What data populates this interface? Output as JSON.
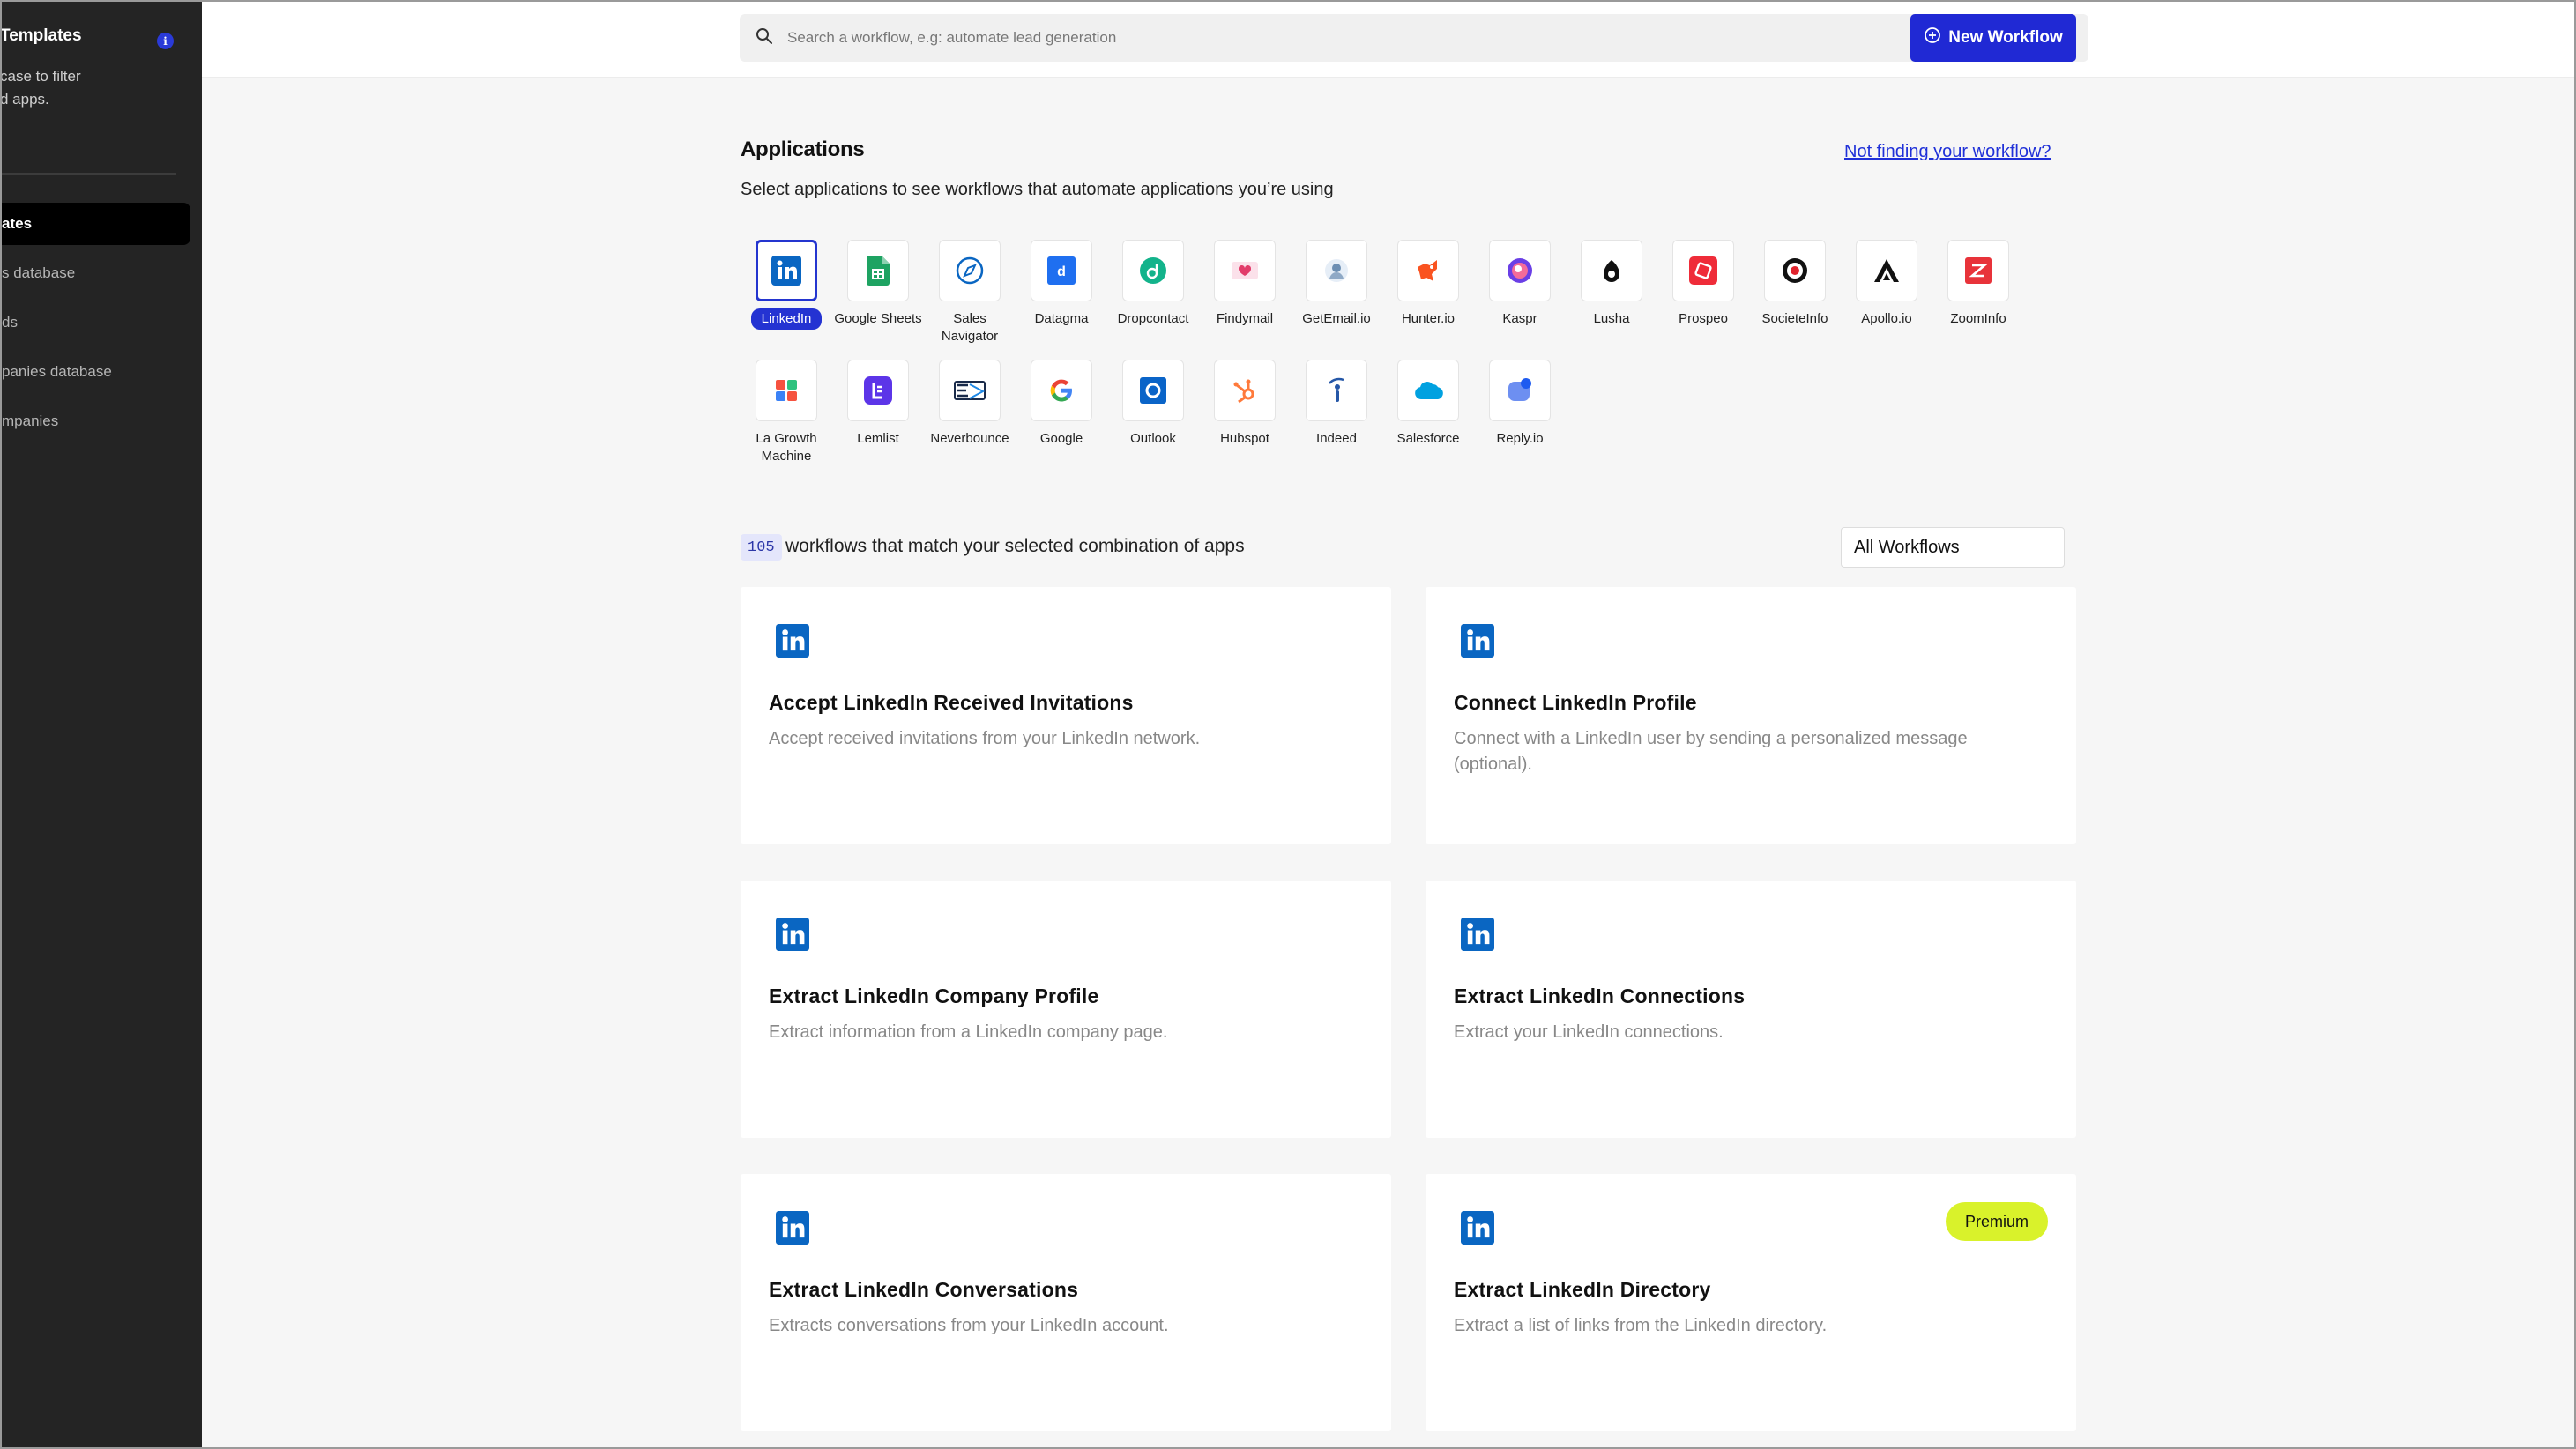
{
  "sidebar": {
    "title": "Templates",
    "info_badge": "i",
    "description": "case to filter\nd apps.",
    "items": [
      {
        "label": "ates",
        "active": true
      },
      {
        "label": "s database",
        "active": false
      },
      {
        "label": "ds",
        "active": false
      },
      {
        "label": "panies database",
        "active": false
      },
      {
        "label": "mpanies",
        "active": false
      }
    ]
  },
  "topbar": {
    "search_placeholder": "Search a workflow, e.g: automate lead generation",
    "new_workflow_label": "New Workflow"
  },
  "applications": {
    "title": "Applications",
    "subtitle": "Select applications to see workflows that automate applications you’re using",
    "not_finding_link": "Not finding your workflow?",
    "apps": [
      {
        "name": "LinkedIn",
        "icon": "linkedin-icon",
        "selected": true
      },
      {
        "name": "Google Sheets",
        "icon": "google-sheets-icon"
      },
      {
        "name": "Sales Navigator",
        "icon": "sales-navigator-icon"
      },
      {
        "name": "Datagma",
        "icon": "datagma-icon"
      },
      {
        "name": "Dropcontact",
        "icon": "dropcontact-icon"
      },
      {
        "name": "Findymail",
        "icon": "findymail-icon"
      },
      {
        "name": "GetEmail.io",
        "icon": "getemail-icon"
      },
      {
        "name": "Hunter.io",
        "icon": "hunter-icon"
      },
      {
        "name": "Kaspr",
        "icon": "kaspr-icon"
      },
      {
        "name": "Lusha",
        "icon": "lusha-icon"
      },
      {
        "name": "Prospeo",
        "icon": "prospeo-icon"
      },
      {
        "name": "SocieteInfo",
        "icon": "societeinfo-icon"
      },
      {
        "name": "Apollo.io",
        "icon": "apollo-icon"
      },
      {
        "name": "ZoomInfo",
        "icon": "zoominfo-icon"
      },
      {
        "name": "La Growth Machine",
        "icon": "la-growth-machine-icon"
      },
      {
        "name": "Lemlist",
        "icon": "lemlist-icon"
      },
      {
        "name": "Neverbounce",
        "icon": "neverbounce-icon"
      },
      {
        "name": "Google",
        "icon": "google-icon"
      },
      {
        "name": "Outlook",
        "icon": "outlook-icon"
      },
      {
        "name": "Hubspot",
        "icon": "hubspot-icon"
      },
      {
        "name": "Indeed",
        "icon": "indeed-icon"
      },
      {
        "name": "Salesforce",
        "icon": "salesforce-icon"
      },
      {
        "name": "Reply.io",
        "icon": "reply-icon"
      }
    ]
  },
  "results": {
    "count": "105",
    "text": "workflows that match your selected combination of apps",
    "filter_value": "All Workflows"
  },
  "cards": [
    {
      "title": "Accept LinkedIn Received Invitations",
      "description": "Accept received invitations from your LinkedIn network.",
      "premium": ""
    },
    {
      "title": "Connect LinkedIn Profile",
      "description": "Connect with a LinkedIn user by sending a personalized message (optional).",
      "premium": ""
    },
    {
      "title": "Extract LinkedIn Company Profile",
      "description": "Extract information from a LinkedIn company page.",
      "premium": ""
    },
    {
      "title": "Extract LinkedIn Connections",
      "description": "Extract your LinkedIn connections.",
      "premium": ""
    },
    {
      "title": "Extract LinkedIn Conversations",
      "description": "Extracts conversations from your LinkedIn account.",
      "premium": ""
    },
    {
      "title": "Extract LinkedIn Directory",
      "description": "Extract a list of links from the LinkedIn directory.",
      "premium": "Premium"
    }
  ],
  "colors": {
    "accent": "#2029d4",
    "linkedin": "#0a66c2",
    "premium": "#d9f22b",
    "sidebar_bg": "#242424"
  }
}
